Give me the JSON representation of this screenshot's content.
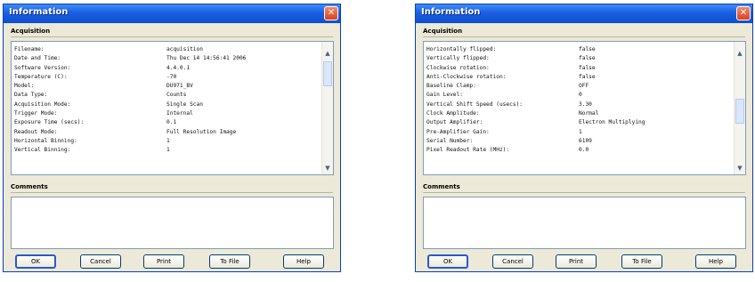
{
  "windows": [
    {
      "title": "Information",
      "close_glyph": "✕",
      "acquisition_label": "Acquisition",
      "comments_label": "Comments",
      "comments_text": "",
      "rows": [
        {
          "key": "Filename:",
          "value": "acquisition"
        },
        {
          "key": "Date and Time:",
          "value": "Thu Dec 14 14:56:41 2006"
        },
        {
          "key": "Software Version:",
          "value": "4.4.0.1"
        },
        {
          "key": "Temperature (C):",
          "value": "-70"
        },
        {
          "key": "Model:",
          "value": "DU971_BV"
        },
        {
          "key": "Data Type:",
          "value": "Counts"
        },
        {
          "key": "Acquisition Mode:",
          "value": "Single Scan"
        },
        {
          "key": "Trigger Mode:",
          "value": "Internal"
        },
        {
          "key": "Exposure Time (secs):",
          "value": "0.1"
        },
        {
          "key": "Readout Mode:",
          "value": "Full Resolution Image"
        },
        {
          "key": "Horizontal Binning:",
          "value": "1"
        },
        {
          "key": "Vertical Binning:",
          "value": "1"
        }
      ],
      "buttons": [
        "OK",
        "Cancel",
        "Print",
        "To File",
        "Help"
      ]
    },
    {
      "title": "Information",
      "close_glyph": "✕",
      "acquisition_label": "Acquisition",
      "comments_label": "Comments",
      "comments_text": "",
      "rows": [
        {
          "key": "Horizontally flipped:",
          "value": "false"
        },
        {
          "key": "Vertically flipped:",
          "value": "false"
        },
        {
          "key": "Clockwise rotation:",
          "value": "false"
        },
        {
          "key": "Anti-Clockwise rotation:",
          "value": "false"
        },
        {
          "key": "Baseline Clamp:",
          "value": "OFF"
        },
        {
          "key": "Gain Level:",
          "value": "0"
        },
        {
          "key": "Vertical Shift Speed (usecs):",
          "value": "3.30"
        },
        {
          "key": "Clock Amplitude:",
          "value": "Normal"
        },
        {
          "key": "Output Amplifier:",
          "value": "Electron Multiplying"
        },
        {
          "key": "Pre-Amplifier Gain:",
          "value": "1"
        },
        {
          "key": "Serial Number:",
          "value": "6109"
        },
        {
          "key": "Pixel Readout Rate (MHz):",
          "value": "0.0"
        }
      ],
      "buttons": [
        "OK",
        "Cancel",
        "Print",
        "To File",
        "Help"
      ]
    }
  ],
  "icons": {
    "scroll_up": "▲",
    "scroll_down": "▼"
  }
}
